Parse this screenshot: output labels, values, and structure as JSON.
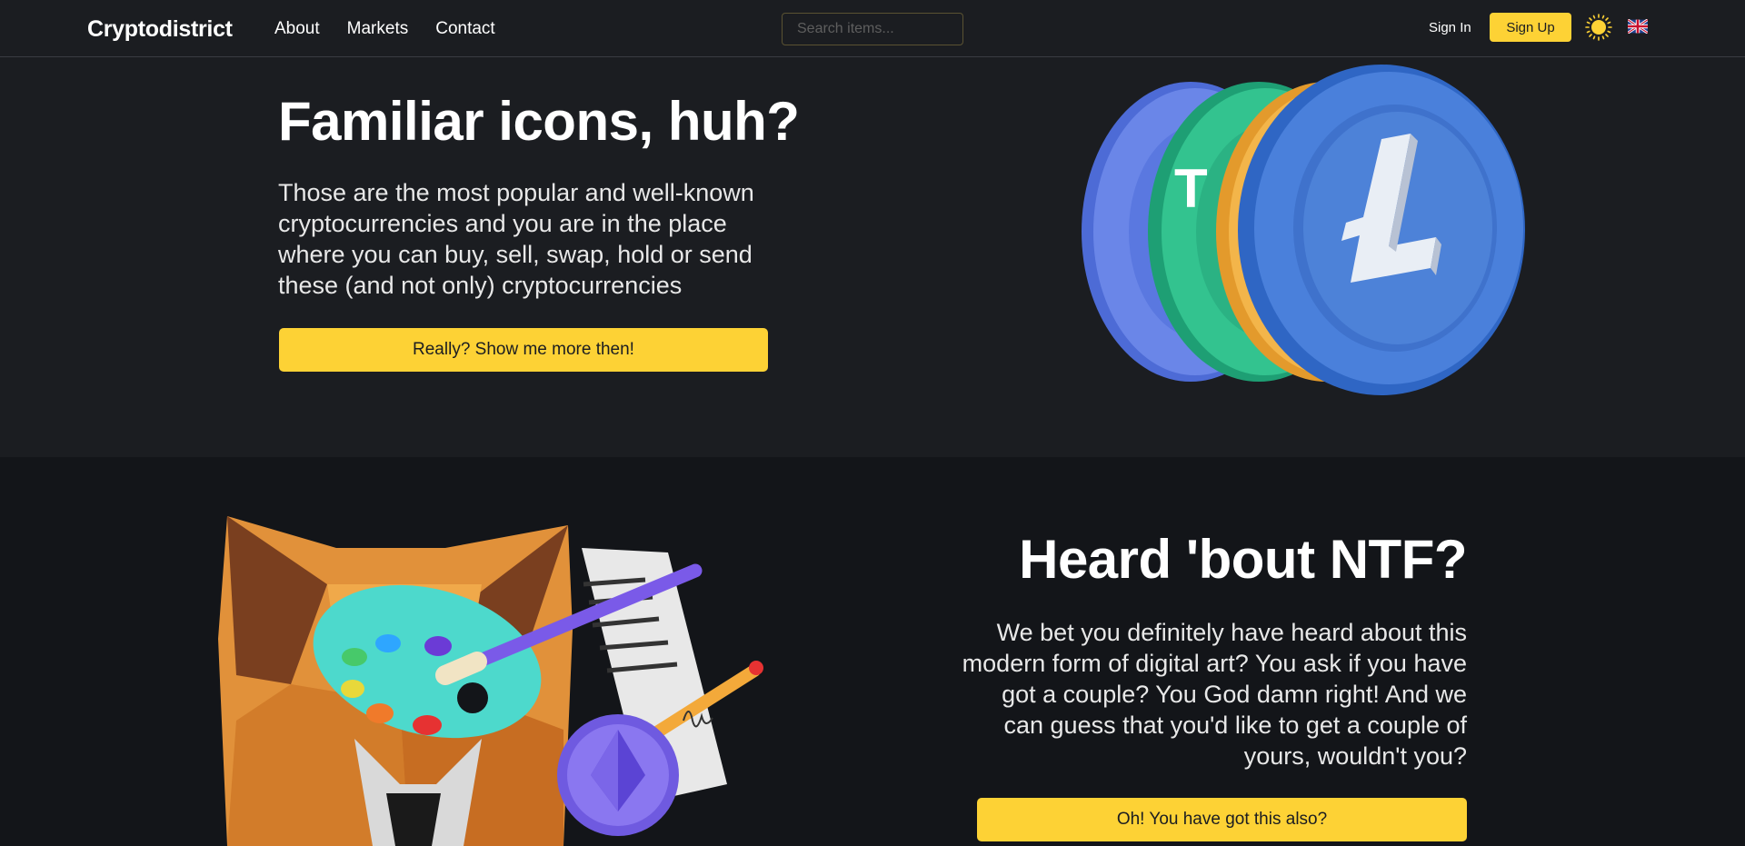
{
  "navbar": {
    "brand": "Cryptodistrict",
    "links": [
      "About",
      "Markets",
      "Contact"
    ],
    "search_placeholder": "Search items...",
    "signin_label": "Sign In",
    "signup_label": "Sign Up",
    "theme_icon": "sun-icon",
    "language_icon": "uk-flag-icon"
  },
  "section1": {
    "title": "Familiar icons, huh?",
    "text": "Those are the most popular and well-known cryptocurrencies and you are in the place where you can buy, sell, swap, hold or send these (and not only) cryptocurrencies",
    "button_label": "Really? Show me more then!",
    "image_icon": "crypto-coins-illustration"
  },
  "section2": {
    "title": "Heard 'bout NTF?",
    "text": "We bet you definitely have heard about this modern form of digital art? You ask if you have got a couple? You God damn right! And we can guess that you'd like to get a couple of yours, wouldn't you?",
    "button_label": "Oh! You have got this also?",
    "image_icon": "nft-fox-palette-illustration"
  },
  "colors": {
    "accent": "#fdd235",
    "background": "#1b1d21",
    "background_alt": "#131519"
  }
}
